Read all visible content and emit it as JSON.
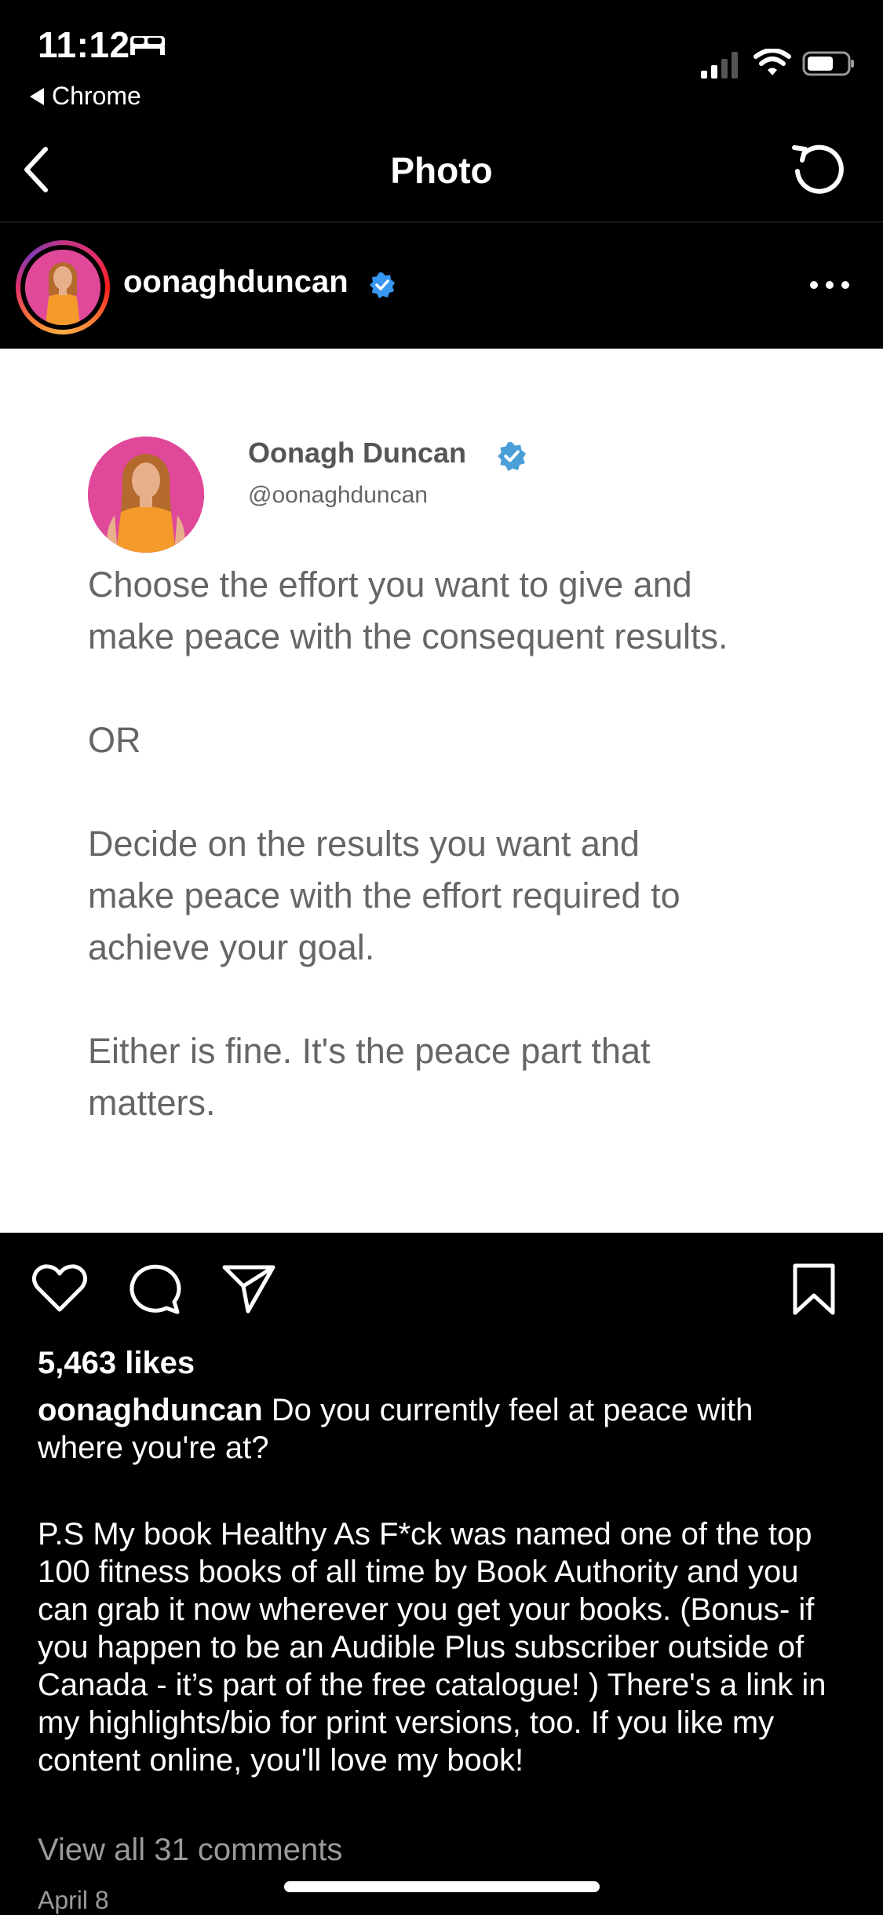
{
  "status_bar": {
    "time": "11:12",
    "back_app": "Chrome",
    "icons": [
      "bed-icon",
      "signal-icon",
      "wifi-icon",
      "battery-icon"
    ]
  },
  "nav": {
    "title": "Photo",
    "back_icon": "chevron-left-icon",
    "refresh_icon": "refresh-icon"
  },
  "post": {
    "username": "oonaghduncan",
    "more_icon": "more-dots-icon"
  },
  "tweet": {
    "name": "Oonagh Duncan",
    "handle": "@oonaghduncan",
    "text": "Choose the effort you want to give and\nmake peace with the consequent results.\n\nOR\n\nDecide on the results you want and\nmake peace with the effort required to\nachieve your goal.\n\nEither is fine. It's the peace part that\nmatters."
  },
  "actions": {
    "icons": [
      "heart-icon",
      "comment-icon",
      "share-icon",
      "bookmark-icon"
    ]
  },
  "likes": "5,463 likes",
  "caption": {
    "username": "oonaghduncan",
    "text": "Do you currently feel at peace with where you're at?"
  },
  "ps_text": "P.S My book Healthy As F*ck was named one of the top 100 fitness books of all time by Book Authority and you can grab it now wherever you get your books. (Bonus- if you happen to be an Audible Plus subscriber outside of Canada - it’s part of the free catalogue! ) There's a link in my highlights/bio for print versions, too. If you like my content online, you'll love my book!",
  "view_comments": "View all 31 comments",
  "date": "April 8",
  "colors": {
    "background": "#000000",
    "verified": "#3897f0",
    "avatar_bg": "#e0489a",
    "outfit": "#f39a2b",
    "muted_text": "#9a9a9a"
  }
}
